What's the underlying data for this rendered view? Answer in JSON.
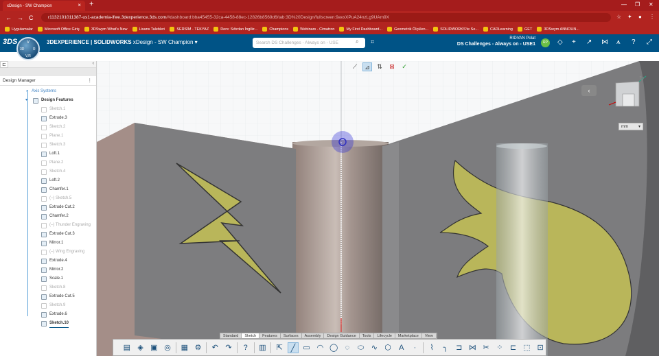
{
  "browser": {
    "tab_title": "xDesign - SW Champion",
    "tab_close": "×",
    "new_tab": "+",
    "url_host": "r1132101011387-us1-academia-ifwe.3dexperience.3ds.com",
    "url_path": "/#dashboard:bba45455-32ca-4458-88ec-12826b8569d6/tab:3D%20Design/fullscreen:9avxXPuA24nzLg9UAm9X",
    "nav_back": "←",
    "nav_forward": "→",
    "nav_reload": "C",
    "bookmarks": [
      "Uygulamalar",
      "Microsoft Office Giriş",
      "3DSwym What's New",
      "Lisans Talebleri",
      "SERSİM - TEKYAZ",
      "Ders: Sıfırdan İngiliz...",
      "Champions",
      "Webinars - Cimatron",
      "My First Dashboard...",
      "Geometrik Ölçülen...",
      "SOLIDWORKS'te Se...",
      "CADLearning",
      "GET",
      "3DSwym ANNOUN..."
    ]
  },
  "app": {
    "brand": "3DEXPERIENCE | SOLIDWORKS",
    "app_name": "xDesign - SW Champion",
    "search_placeholder": "Search DS Challenges - Always on - USE",
    "user_name": "RIDVAN Polat",
    "tenant": "DS Challenges - Always on - USE1",
    "avatar_initials": "RP",
    "compass": {
      "v": "V",
      "left": "3D",
      "right": "R",
      "bottom": "V,R"
    }
  },
  "design_manager": {
    "title": "Design Manager",
    "menu": "⋮",
    "collapse": "‹",
    "items": [
      {
        "label": "Axis Systems",
        "state": "link"
      },
      {
        "label": "Design Features",
        "state": "open"
      },
      {
        "label": "Sketch.1",
        "state": "grey"
      },
      {
        "label": "Extrude.3",
        "state": "normal"
      },
      {
        "label": "Sketch.2",
        "state": "grey"
      },
      {
        "label": "Plane.1",
        "state": "grey"
      },
      {
        "label": "Sketch.3",
        "state": "grey"
      },
      {
        "label": "Loft.1",
        "state": "normal"
      },
      {
        "label": "Plane.2",
        "state": "grey"
      },
      {
        "label": "Sketch.4",
        "state": "grey"
      },
      {
        "label": "Loft.2",
        "state": "normal"
      },
      {
        "label": "Chamfer.1",
        "state": "normal"
      },
      {
        "label": "(–)  Sketch.5",
        "state": "dash"
      },
      {
        "label": "Extrude Cut.2",
        "state": "normal"
      },
      {
        "label": "Chamfer.2",
        "state": "normal"
      },
      {
        "label": "(–)  Thunder Engraving",
        "state": "dash"
      },
      {
        "label": "Extrude Cut.3",
        "state": "normal"
      },
      {
        "label": "Mirror.1",
        "state": "normal"
      },
      {
        "label": "(–)  Wing Engraving",
        "state": "dash"
      },
      {
        "label": "Extrude.4",
        "state": "normal"
      },
      {
        "label": "Mirror.2",
        "state": "normal"
      },
      {
        "label": "Scale.1",
        "state": "normal"
      },
      {
        "label": "Sketch.8",
        "state": "grey"
      },
      {
        "label": "Extrude Cut.5",
        "state": "normal"
      },
      {
        "label": "Sketch.9",
        "state": "grey"
      },
      {
        "label": "Extrude.6",
        "state": "normal"
      },
      {
        "label": "Sketch.10",
        "state": "active"
      }
    ]
  },
  "viewport": {
    "unit": "mm",
    "back": "‹",
    "colors": {
      "engraving": "#b9b65a",
      "body": "#7d7d7f",
      "face_light": "#9a9a9c",
      "accent": "#005386"
    }
  },
  "command_tabs": [
    "Standard",
    "Sketch",
    "Features",
    "Surfaces",
    "Assembly",
    "Design Guidance",
    "Tools",
    "Lifecycle",
    "Marketplace",
    "View"
  ],
  "active_command_tab": "Sketch"
}
